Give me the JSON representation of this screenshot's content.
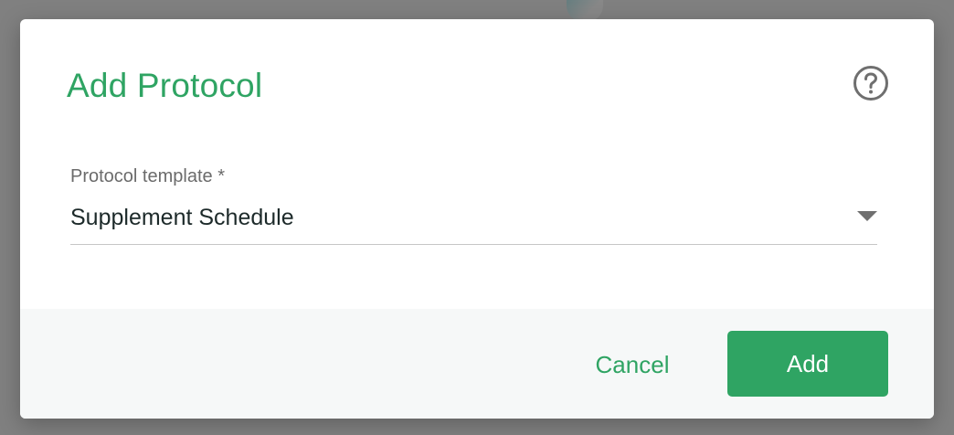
{
  "dialog": {
    "title": "Add Protocol",
    "help_icon": "help-circle-icon"
  },
  "form": {
    "protocol_template": {
      "label": "Protocol template *",
      "value": "Supplement Schedule",
      "icon": "caret-down-icon"
    }
  },
  "actions": {
    "cancel_label": "Cancel",
    "add_label": "Add"
  },
  "colors": {
    "accent": "#2fa463",
    "overlay": "#808080",
    "footer_bg": "#f6f8f8",
    "icon_gray": "#6f6f6f"
  }
}
